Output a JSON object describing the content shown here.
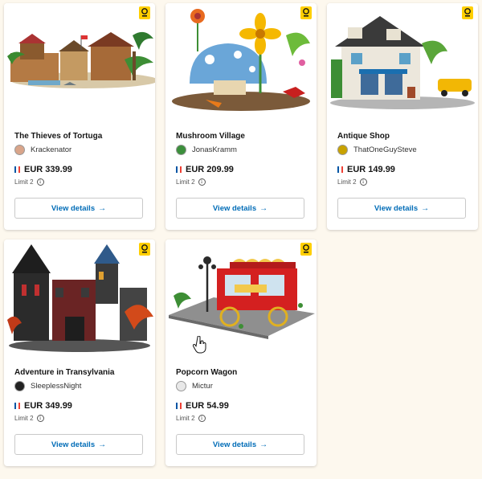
{
  "products": [
    {
      "title": "The Thieves of Tortuga",
      "creator": "Krackenator",
      "price": "EUR 339.99",
      "limit": "Limit 2",
      "button_label": "View details",
      "image_icon": "pirate-island-image",
      "avatar_color": "#d9a58a"
    },
    {
      "title": "Mushroom Village",
      "creator": "JonasKramm",
      "price": "EUR 209.99",
      "limit": "Limit 2",
      "button_label": "View details",
      "image_icon": "mushroom-village-image",
      "avatar_color": "#3c8f3c"
    },
    {
      "title": "Antique Shop",
      "creator": "ThatOneGuySteve",
      "price": "EUR 149.99",
      "limit": "Limit 2",
      "button_label": "View details",
      "image_icon": "antique-shop-image",
      "avatar_color": "#c8a200"
    },
    {
      "title": "Adventure in Transylvania",
      "creator": "SleeplessNight",
      "price": "EUR 349.99",
      "limit": "Limit 2",
      "button_label": "View details",
      "image_icon": "castle-image",
      "avatar_color": "#222222"
    },
    {
      "title": "Popcorn Wagon",
      "creator": "Mictur",
      "price": "EUR 54.99",
      "limit": "Limit 2",
      "button_label": "View details",
      "image_icon": "popcorn-wagon-image",
      "avatar_color": "#e8e8e8"
    }
  ],
  "colors": {
    "background": "#fdf8ee",
    "badge": "#ffcf00",
    "link_blue": "#006cb7"
  }
}
